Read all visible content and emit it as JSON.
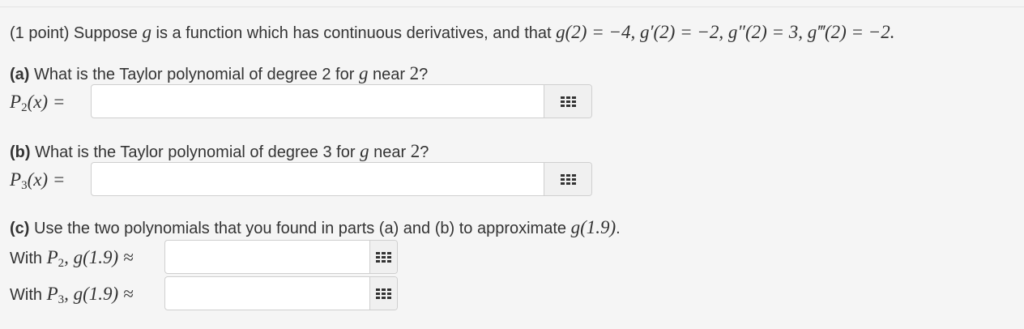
{
  "intro": {
    "prefix": "(1 point) Suppose ",
    "var": "g",
    "middle": " is a function which has continuous derivatives, and that ",
    "conditions": "g(2) = −4, g′(2) = −2, g″(2) = 3, g‴(2) = −2."
  },
  "parts": {
    "a": {
      "tag": "(a)",
      "text_before": " What is the Taylor polynomial of degree 2 for ",
      "var": "g",
      "text_mid": " near ",
      "point": "2",
      "text_after": "?",
      "lhs_P": "P",
      "lhs_sub": "2",
      "lhs_rest": "(x) =",
      "value": ""
    },
    "b": {
      "tag": "(b)",
      "text_before": " What is the Taylor polynomial of degree 3 for ",
      "var": "g",
      "text_mid": " near ",
      "point": "2",
      "text_after": "?",
      "lhs_P": "P",
      "lhs_sub": "3",
      "lhs_rest": "(x) =",
      "value": ""
    },
    "c": {
      "tag": "(c)",
      "text": " Use the two polynomials that you found in parts (a) and (b) to approximate ",
      "expr": "g(1.9)",
      "end": ".",
      "rows": [
        {
          "with": "With ",
          "P": "P",
          "sub": "2",
          "approx": ", g(1.9) ≈",
          "value": ""
        },
        {
          "with": "With ",
          "P": "P",
          "sub": "3",
          "approx": ", g(1.9) ≈",
          "value": ""
        }
      ]
    }
  }
}
